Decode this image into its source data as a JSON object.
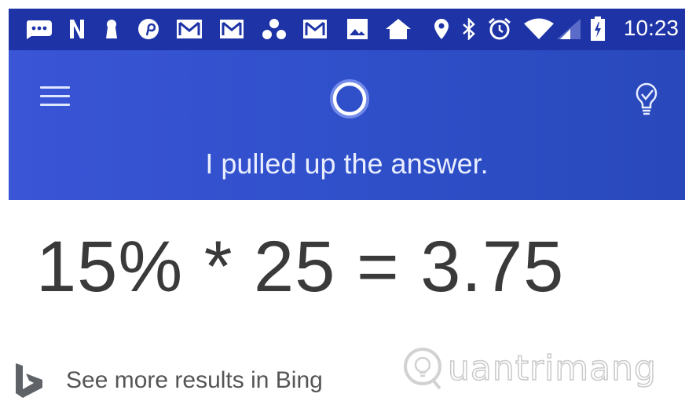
{
  "status_bar": {
    "time": "10:23",
    "icons": [
      "message-icon",
      "n-icon",
      "keyhole-icon",
      "pinterest-icon",
      "gmail-icon",
      "gmail-icon",
      "dots-icon",
      "gmail-icon",
      "image-icon",
      "home-icon",
      "location-icon",
      "bluetooth-icon",
      "alarm-icon",
      "wifi-icon",
      "signal-icon",
      "battery-charging-icon"
    ]
  },
  "header": {
    "message": "I pulled up the answer."
  },
  "result": {
    "expression": "15% * 25 = 3.75"
  },
  "footer": {
    "bing_link": "See more results in Bing",
    "watermark": "uantrimang"
  },
  "colors": {
    "status_bar": "#1d33a6",
    "app_bar": "#3050cb",
    "answer_text": "#3a3a3a"
  }
}
